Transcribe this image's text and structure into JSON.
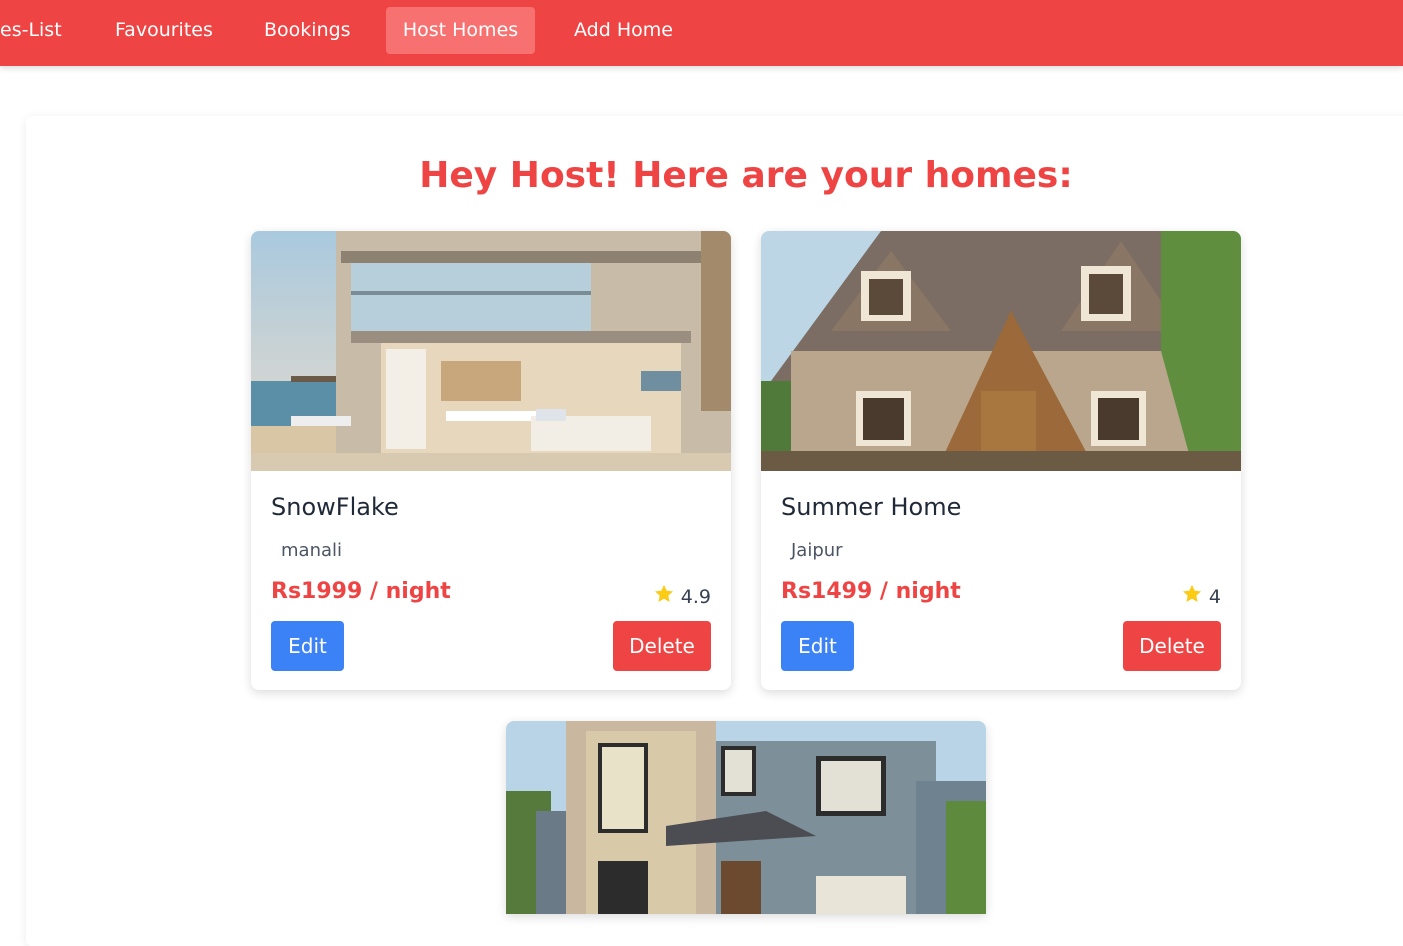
{
  "nav": {
    "items": [
      {
        "label": "es-List",
        "active": false
      },
      {
        "label": "Favourites",
        "active": false
      },
      {
        "label": "Bookings",
        "active": false
      },
      {
        "label": "Host Homes",
        "active": true
      },
      {
        "label": "Add Home",
        "active": false
      }
    ]
  },
  "page": {
    "heading": "Hey Host! Here are your homes:"
  },
  "homes": [
    {
      "name": "SnowFlake",
      "location": "manali",
      "price": "Rs1999 / night",
      "rating": "4.9",
      "edit_label": "Edit",
      "delete_label": "Delete"
    },
    {
      "name": "Summer Home",
      "location": "Jaipur",
      "price": "Rs1499 / night",
      "rating": "4",
      "edit_label": "Edit",
      "delete_label": "Delete"
    },
    {
      "name": "",
      "location": "",
      "price": "",
      "rating": "",
      "edit_label": "",
      "delete_label": ""
    }
  ],
  "colors": {
    "brand": "#ef4444",
    "edit": "#3b82f6",
    "star": "#facc15"
  }
}
